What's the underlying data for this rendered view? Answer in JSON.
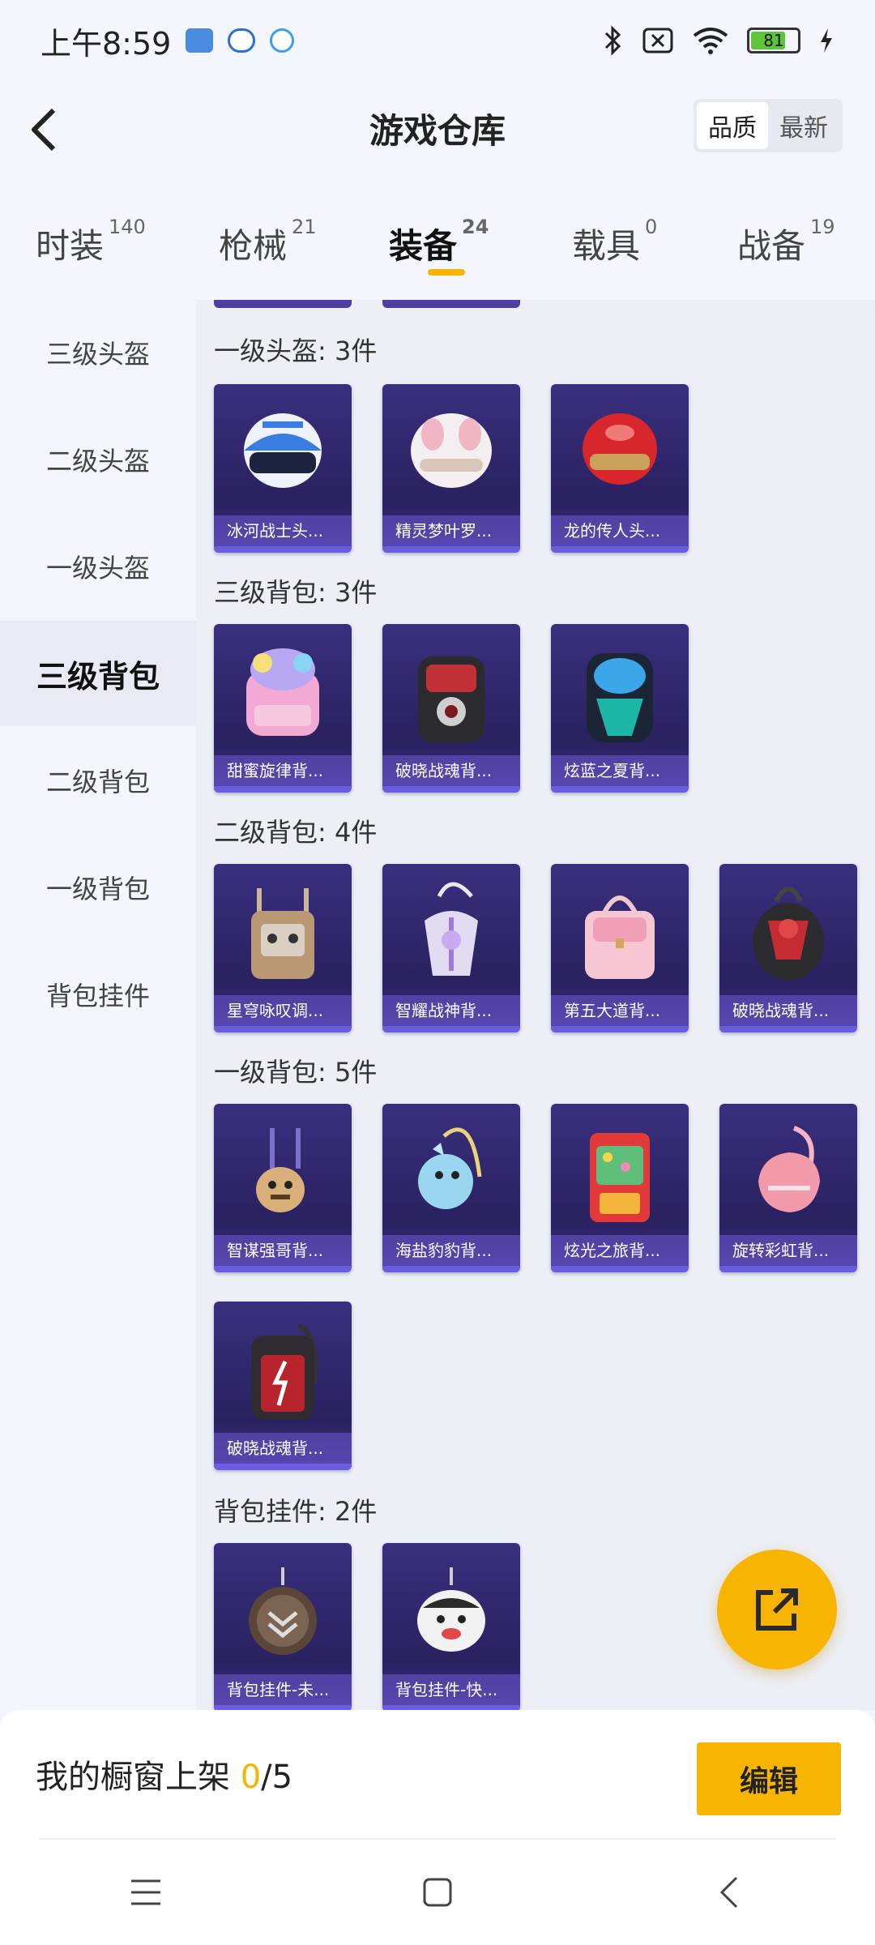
{
  "status": {
    "time": "上午8:59",
    "battery": "81"
  },
  "header": {
    "title": "游戏仓库",
    "sort_options": [
      "品质",
      "最新"
    ]
  },
  "tabs": [
    {
      "label": "时装",
      "count": "140"
    },
    {
      "label": "枪械",
      "count": "21"
    },
    {
      "label": "装备",
      "count": "24"
    },
    {
      "label": "载具",
      "count": "0"
    },
    {
      "label": "战备",
      "count": "19"
    }
  ],
  "sidebar": [
    "三级头盔",
    "二级头盔",
    "一级头盔",
    "三级背包",
    "二级背包",
    "一级背包",
    "背包挂件"
  ],
  "sections": [
    {
      "title": "一级头盔: 3件",
      "items": [
        "冰河战士头...",
        "精灵梦叶罗...",
        "龙的传人头..."
      ]
    },
    {
      "title": "三级背包: 3件",
      "items": [
        "甜蜜旋律背...",
        "破晓战魂背...",
        "炫蓝之夏背..."
      ]
    },
    {
      "title": "二级背包: 4件",
      "items": [
        "星穹咏叹调...",
        "智耀战神背...",
        "第五大道背...",
        "破晓战魂背..."
      ]
    },
    {
      "title": "一级背包: 5件",
      "items": [
        "智谋强哥背...",
        "海盐豹豹背...",
        "炫光之旅背...",
        "旋转彩虹背...",
        "破晓战魂背..."
      ]
    },
    {
      "title": "背包挂件: 2件",
      "items": [
        "背包挂件-未...",
        "背包挂件-快..."
      ]
    }
  ],
  "bottom": {
    "label": "我的橱窗上架",
    "current": "0",
    "total": "/5",
    "edit_label": "编辑"
  },
  "colors": {
    "accent": "#f7b400",
    "card_bg": "#2a2160"
  },
  "icons": [
    "back-arrow-icon",
    "share-export-icon",
    "menu-icon",
    "home-icon",
    "back-icon"
  ]
}
